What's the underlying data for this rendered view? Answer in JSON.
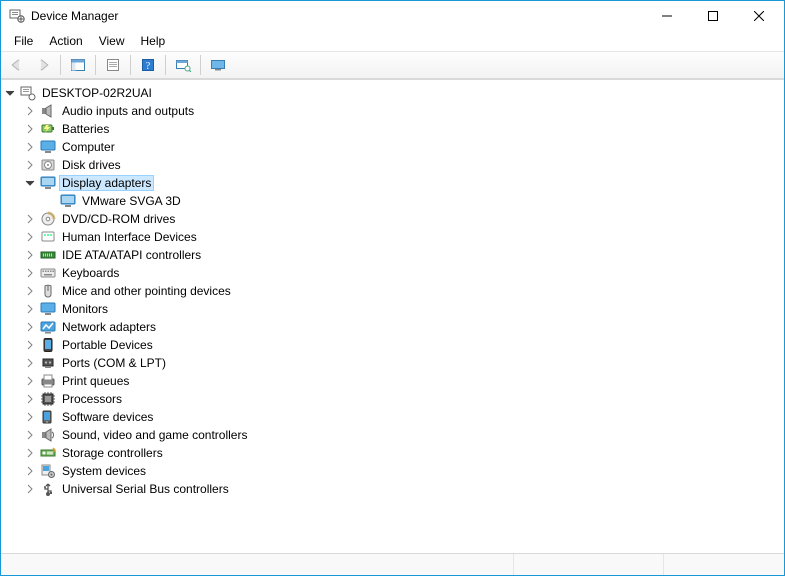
{
  "window": {
    "title": "Device Manager"
  },
  "menu": {
    "file": "File",
    "action": "Action",
    "view": "View",
    "help": "Help"
  },
  "tree": {
    "root": "DESKTOP-02R2UAI",
    "items": [
      {
        "label": "Audio inputs and outputs",
        "icon": "audio"
      },
      {
        "label": "Batteries",
        "icon": "battery"
      },
      {
        "label": "Computer",
        "icon": "monitor"
      },
      {
        "label": "Disk drives",
        "icon": "disk"
      },
      {
        "label": "Display adapters",
        "icon": "display",
        "expanded": true,
        "selected": true,
        "children": [
          {
            "label": "VMware SVGA 3D",
            "icon": "display"
          }
        ]
      },
      {
        "label": "DVD/CD-ROM drives",
        "icon": "dvd"
      },
      {
        "label": "Human Interface Devices",
        "icon": "hid"
      },
      {
        "label": "IDE ATA/ATAPI controllers",
        "icon": "ide"
      },
      {
        "label": "Keyboards",
        "icon": "keyboard"
      },
      {
        "label": "Mice and other pointing devices",
        "icon": "mouse"
      },
      {
        "label": "Monitors",
        "icon": "monitor"
      },
      {
        "label": "Network adapters",
        "icon": "network"
      },
      {
        "label": "Portable Devices",
        "icon": "portable"
      },
      {
        "label": "Ports (COM & LPT)",
        "icon": "port"
      },
      {
        "label": "Print queues",
        "icon": "printer"
      },
      {
        "label": "Processors",
        "icon": "cpu"
      },
      {
        "label": "Software devices",
        "icon": "software"
      },
      {
        "label": "Sound, video and game controllers",
        "icon": "sound"
      },
      {
        "label": "Storage controllers",
        "icon": "storage"
      },
      {
        "label": "System devices",
        "icon": "system"
      },
      {
        "label": "Universal Serial Bus controllers",
        "icon": "usb"
      }
    ]
  }
}
